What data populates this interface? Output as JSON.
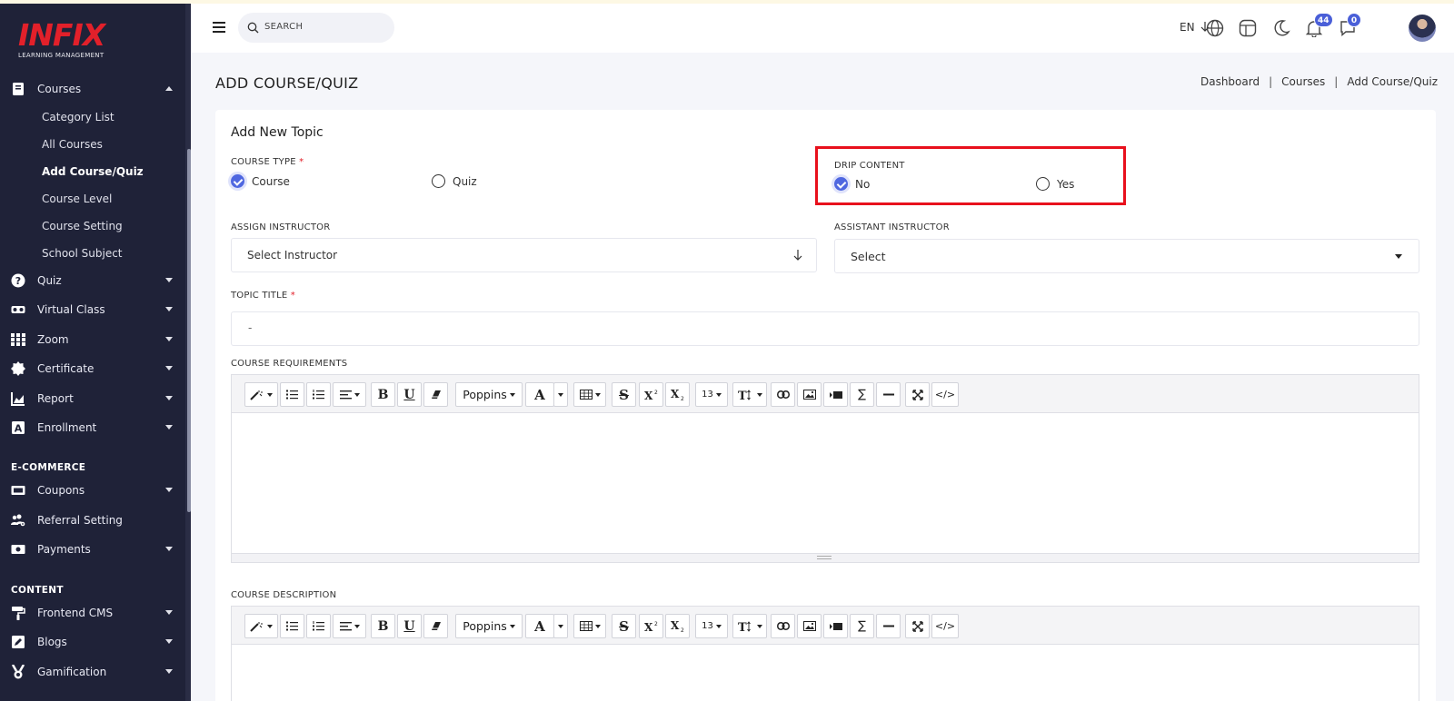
{
  "brand": {
    "logo_text": "INFIX",
    "tagline": "LEARNING MANAGEMENT"
  },
  "sidebar": {
    "courses": {
      "label": "Courses",
      "children": [
        "Category List",
        "All Courses",
        "Add Course/Quiz",
        "Course Level",
        "Course Setting",
        "School Subject"
      ],
      "active_child": "Add Course/Quiz"
    },
    "items": [
      "Quiz",
      "Virtual Class",
      "Zoom",
      "Certificate",
      "Report",
      "Enrollment"
    ],
    "ecommerce": {
      "heading": "E-COMMERCE",
      "items": [
        "Coupons",
        "Referral Setting",
        "Payments"
      ]
    },
    "content": {
      "heading": "CONTENT",
      "items": [
        "Frontend CMS",
        "Blogs",
        "Gamification"
      ]
    }
  },
  "header": {
    "search_label": "SEARCH",
    "language": "EN",
    "notifications_count": "44",
    "messages_count": "0"
  },
  "page": {
    "title": "ADD COURSE/QUIZ",
    "breadcrumb": [
      "Dashboard",
      "Courses",
      "Add Course/Quiz"
    ],
    "breadcrumb_separator": "|"
  },
  "form": {
    "card_title": "Add New Topic",
    "course_type": {
      "label": "COURSE TYPE",
      "required_mark": "*",
      "options": [
        "Course",
        "Quiz"
      ],
      "selected": "Course"
    },
    "drip_content": {
      "label": "DRIP CONTENT",
      "options": [
        "No",
        "Yes"
      ],
      "selected": "No"
    },
    "assign_instructor": {
      "label": "ASSIGN INSTRUCTOR",
      "value": "Select Instructor"
    },
    "assistant_instructor": {
      "label": "ASSISTANT INSTRUCTOR",
      "value": "Select"
    },
    "topic_title": {
      "label": "TOPIC TITLE",
      "required_mark": "*",
      "value": "-"
    },
    "course_requirements": {
      "label": "COURSE REQUIREMENTS"
    },
    "course_description": {
      "label": "COURSE DESCRIPTION"
    },
    "editor_toolbar": {
      "font_name": "Poppins",
      "font_size": "13"
    }
  },
  "colors": {
    "sidebar_bg": "#1f2238",
    "accent": "#4f67e0",
    "brand_red": "#e2202a",
    "highlight_box": "#e8101c"
  }
}
